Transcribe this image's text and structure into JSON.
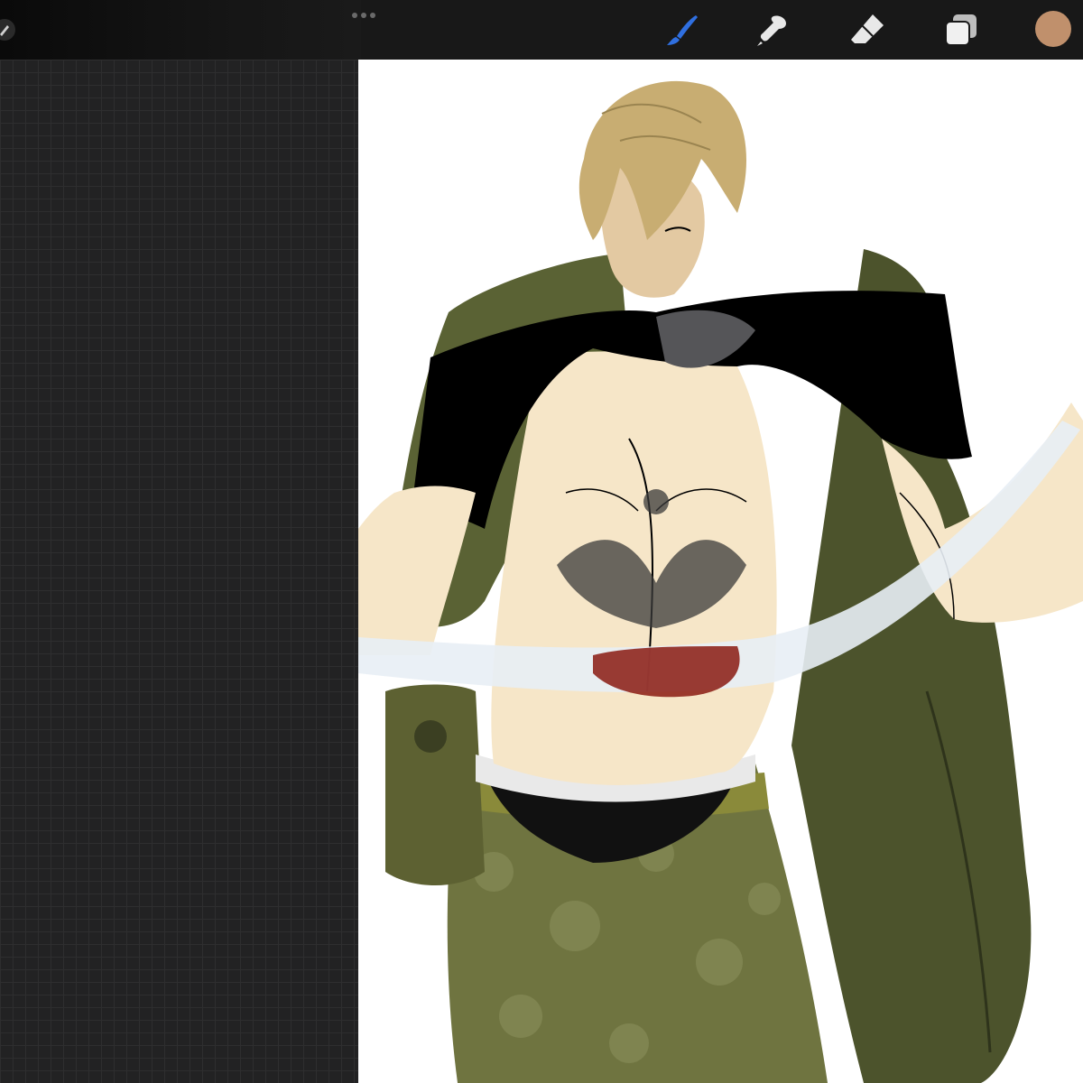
{
  "app": {
    "accent": "#2f6fe0",
    "selected_color": "#c0906c"
  },
  "toolbar": {
    "left_icons": [
      "actions-icon",
      "more-options-icon"
    ],
    "tools": [
      {
        "name": "brush-icon",
        "active": true
      },
      {
        "name": "smudge-icon",
        "active": false
      },
      {
        "name": "eraser-icon",
        "active": false
      },
      {
        "name": "layers-icon",
        "active": false
      }
    ]
  },
  "canvas": {
    "background": "#ffffff",
    "palette": {
      "hair": "#c8ad72",
      "skin": "#f6e6c8",
      "skin_shade": "#d9bf98",
      "jacket": "#5a6234",
      "jacket_dark": "#3f4526",
      "shirt": "#000000",
      "pants": "#6f7440",
      "belt": "#8a8a3a",
      "blood": "#8a1a12",
      "bandage": "#e8eef5"
    }
  }
}
